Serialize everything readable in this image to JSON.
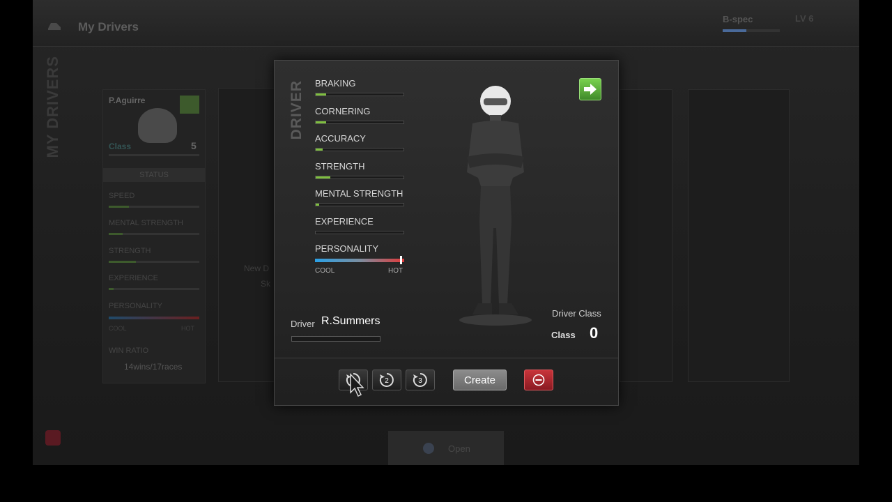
{
  "header": {
    "title": "My Drivers",
    "bspec": "B-spec",
    "level": "LV 6",
    "bspec_progress": 0.42
  },
  "side_label": "MY DRIVERS",
  "bg_card": {
    "name": "P.Aguirre",
    "class_label": "Class",
    "class_value": "5",
    "status": "STATUS",
    "stats": [
      {
        "label": "SPEED",
        "value": 0.22
      },
      {
        "label": "MENTAL STRENGTH",
        "value": 0.15
      },
      {
        "label": "STRENGTH",
        "value": 0.3
      },
      {
        "label": "EXPERIENCE",
        "value": 0.05
      }
    ],
    "personality_label": "PERSONALITY",
    "cool": "COOL",
    "hot": "HOT",
    "win_ratio_label": "WIN RATIO",
    "win_ratio": "14wins/17races"
  },
  "bg_card2_text": [
    "New D",
    "Sk"
  ],
  "open_label": "Open",
  "dialog": {
    "vertical_label": "DRIVER",
    "stats": [
      {
        "label": "BRAKING",
        "value": 0.12
      },
      {
        "label": "CORNERING",
        "value": 0.12
      },
      {
        "label": "ACCURACY",
        "value": 0.08
      },
      {
        "label": "STRENGTH",
        "value": 0.17
      },
      {
        "label": "MENTAL STRENGTH",
        "value": 0.04
      },
      {
        "label": "EXPERIENCE",
        "value": 0.0
      }
    ],
    "personality": {
      "label": "PERSONALITY",
      "cool": "COOL",
      "hot": "HOT",
      "value": 0.97
    },
    "driver_label": "Driver",
    "driver_name": "R.Summers",
    "driver_class_label": "Driver Class",
    "class_word": "Class",
    "class_value": "0",
    "slot_buttons": [
      "1",
      "2",
      "3"
    ],
    "create_label": "Create",
    "colors": {
      "stat_fill": "#7fbf3f",
      "delete": "#c8343a",
      "arrow": "#5ab53a"
    }
  }
}
